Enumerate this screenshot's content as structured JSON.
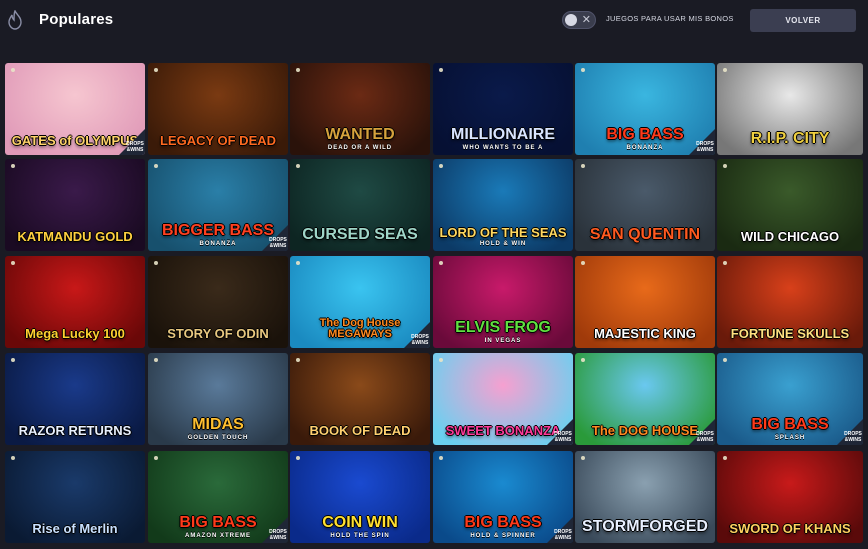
{
  "header": {
    "logo_icon": "flame-icon",
    "title": "Populares",
    "toggle_label": "JUEGOS PARA USAR MIS BONOS",
    "toggle_state": "off",
    "back_label": "VOLVER"
  },
  "badge_text": {
    "line1": "DROPS",
    "line2": "&WINS"
  },
  "games": [
    {
      "title": "GATES of OLYMPUS",
      "subtitle": "",
      "bg": [
        "#f6c6d0",
        "#e09ab8"
      ],
      "color": "#ffd36a",
      "badge": true
    },
    {
      "title": "LEGACY OF DEAD",
      "subtitle": "",
      "bg": [
        "#7a3a12",
        "#3a1a08"
      ],
      "color": "#ff6a20",
      "badge": false
    },
    {
      "title": "WANTED",
      "subtitle": "DEAD OR A WILD",
      "bg": [
        "#6b2a14",
        "#2a120a"
      ],
      "color": "#d6a23c",
      "badge": false
    },
    {
      "title": "MILLIONAIRE",
      "subtitle": "WHO WANTS TO BE A",
      "bg": [
        "#0a1a4a",
        "#061033"
      ],
      "color": "#d8e4ff",
      "badge": false
    },
    {
      "title": "BIG BASS",
      "subtitle": "BONANZA",
      "bg": [
        "#3ab6e0",
        "#1f7fb0"
      ],
      "color": "#ff3a1a",
      "badge": true
    },
    {
      "title": "R.I.P. CITY",
      "subtitle": "",
      "bg": [
        "#e8e8e8",
        "#777777"
      ],
      "color": "#f0d040",
      "badge": false
    },
    {
      "title": "KATMANDU GOLD",
      "subtitle": "",
      "bg": [
        "#3a1a4a",
        "#1a0a22"
      ],
      "color": "#ffd040",
      "badge": false
    },
    {
      "title": "BIGGER BASS",
      "subtitle": "BONANZA",
      "bg": [
        "#2a7fa8",
        "#17506d"
      ],
      "color": "#ff4020",
      "badge": true
    },
    {
      "title": "CURSED SEAS",
      "subtitle": "",
      "bg": [
        "#1f4a44",
        "#0d2522"
      ],
      "color": "#9fd6c8",
      "badge": false
    },
    {
      "title": "LORD OF THE SEAS",
      "subtitle": "HOLD & WIN",
      "bg": [
        "#1a7ab8",
        "#0c3a66"
      ],
      "color": "#ffd860",
      "badge": false
    },
    {
      "title": "SAN QUENTIN",
      "subtitle": "",
      "bg": [
        "#4a5a6a",
        "#2a323a"
      ],
      "color": "#ff5a20",
      "badge": false
    },
    {
      "title": "WILD CHICAGO",
      "subtitle": "",
      "bg": [
        "#3a5a2a",
        "#1a2a12"
      ],
      "color": "#ffffff",
      "badge": false
    },
    {
      "title": "Mega Lucky 100",
      "subtitle": "",
      "bg": [
        "#c81818",
        "#6a0808"
      ],
      "color": "#ffd030",
      "badge": false
    },
    {
      "title": "STORY OF ODIN",
      "subtitle": "",
      "bg": [
        "#3a2a1a",
        "#1a120a"
      ],
      "color": "#e8c880",
      "badge": false
    },
    {
      "title": "The Dog House MEGAWAYS",
      "subtitle": "",
      "bg": [
        "#3ac4f0",
        "#1a8ac0"
      ],
      "color": "#ff8a20",
      "badge": true
    },
    {
      "title": "ELVIS FROG",
      "subtitle": "IN VEGAS",
      "bg": [
        "#c81a6a",
        "#6a0a3a"
      ],
      "color": "#60e040",
      "badge": false
    },
    {
      "title": "MAJESTIC KING",
      "subtitle": "",
      "bg": [
        "#e86a1a",
        "#a03a0a"
      ],
      "color": "#ffffff",
      "badge": false
    },
    {
      "title": "FORTUNE SKULLS",
      "subtitle": "",
      "bg": [
        "#d8401a",
        "#6a1a0a"
      ],
      "color": "#ffe080",
      "badge": false
    },
    {
      "title": "RAZOR RETURNS",
      "subtitle": "",
      "bg": [
        "#1a3a8a",
        "#0a1a44"
      ],
      "color": "#e8f0ff",
      "badge": false
    },
    {
      "title": "MIDAS",
      "subtitle": "GOLDEN TOUCH",
      "bg": [
        "#5a7a9a",
        "#2a3a4a"
      ],
      "color": "#ffc030",
      "badge": false
    },
    {
      "title": "BOOK OF DEAD",
      "subtitle": "",
      "bg": [
        "#8a4a1a",
        "#3a1a0a"
      ],
      "color": "#ffd070",
      "badge": false
    },
    {
      "title": "SWEET BONANZA",
      "subtitle": "",
      "bg": [
        "#f6a0d0",
        "#6ad0f0"
      ],
      "color": "#ff3a9a",
      "badge": true
    },
    {
      "title": "The DOG HOUSE",
      "subtitle": "",
      "bg": [
        "#6ac8f0",
        "#2a9a3a"
      ],
      "color": "#ff8a20",
      "badge": true
    },
    {
      "title": "BIG BASS",
      "subtitle": "SPLASH",
      "bg": [
        "#3aa0d0",
        "#1a5a8a"
      ],
      "color": "#ff3a1a",
      "badge": true
    },
    {
      "title": "Rise of Merlin",
      "subtitle": "",
      "bg": [
        "#1a3a6a",
        "#0a1a33"
      ],
      "color": "#c8e0ff",
      "badge": false
    },
    {
      "title": "BIG BASS",
      "subtitle": "AMAZON XTREME",
      "bg": [
        "#2a6a3a",
        "#123a1a"
      ],
      "color": "#ff3a1a",
      "badge": true
    },
    {
      "title": "COIN WIN",
      "subtitle": "HOLD THE SPIN",
      "bg": [
        "#1a4ad0",
        "#0a2a8a"
      ],
      "color": "#ffe030",
      "badge": false
    },
    {
      "title": "BIG BASS",
      "subtitle": "HOLD & SPINNER",
      "bg": [
        "#1a8ad0",
        "#0a4a8a"
      ],
      "color": "#ff3a1a",
      "badge": true
    },
    {
      "title": "STORMFORGED",
      "subtitle": "",
      "bg": [
        "#8aa0b0",
        "#3a4a5a"
      ],
      "color": "#e8f0ff",
      "badge": false
    },
    {
      "title": "SWORD OF KHANS",
      "subtitle": "",
      "bg": [
        "#c81a1a",
        "#5a0a0a"
      ],
      "color": "#ffd060",
      "badge": false
    }
  ]
}
